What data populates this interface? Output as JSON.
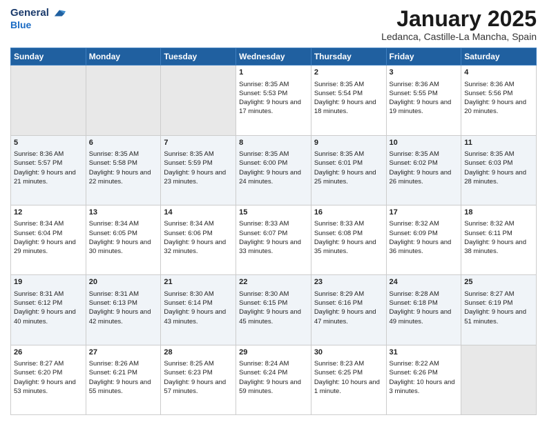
{
  "header": {
    "logo_general": "General",
    "logo_blue": "Blue",
    "month_title": "January 2025",
    "location": "Ledanca, Castille-La Mancha, Spain"
  },
  "weekdays": [
    "Sunday",
    "Monday",
    "Tuesday",
    "Wednesday",
    "Thursday",
    "Friday",
    "Saturday"
  ],
  "weeks": [
    [
      {
        "day": "",
        "empty": true
      },
      {
        "day": "",
        "empty": true
      },
      {
        "day": "",
        "empty": true
      },
      {
        "day": "1",
        "sunrise": "8:35 AM",
        "sunset": "5:53 PM",
        "daylight": "9 hours and 17 minutes."
      },
      {
        "day": "2",
        "sunrise": "8:35 AM",
        "sunset": "5:54 PM",
        "daylight": "9 hours and 18 minutes."
      },
      {
        "day": "3",
        "sunrise": "8:36 AM",
        "sunset": "5:55 PM",
        "daylight": "9 hours and 19 minutes."
      },
      {
        "day": "4",
        "sunrise": "8:36 AM",
        "sunset": "5:56 PM",
        "daylight": "9 hours and 20 minutes."
      }
    ],
    [
      {
        "day": "5",
        "sunrise": "8:36 AM",
        "sunset": "5:57 PM",
        "daylight": "9 hours and 21 minutes."
      },
      {
        "day": "6",
        "sunrise": "8:35 AM",
        "sunset": "5:58 PM",
        "daylight": "9 hours and 22 minutes."
      },
      {
        "day": "7",
        "sunrise": "8:35 AM",
        "sunset": "5:59 PM",
        "daylight": "9 hours and 23 minutes."
      },
      {
        "day": "8",
        "sunrise": "8:35 AM",
        "sunset": "6:00 PM",
        "daylight": "9 hours and 24 minutes."
      },
      {
        "day": "9",
        "sunrise": "8:35 AM",
        "sunset": "6:01 PM",
        "daylight": "9 hours and 25 minutes."
      },
      {
        "day": "10",
        "sunrise": "8:35 AM",
        "sunset": "6:02 PM",
        "daylight": "9 hours and 26 minutes."
      },
      {
        "day": "11",
        "sunrise": "8:35 AM",
        "sunset": "6:03 PM",
        "daylight": "9 hours and 28 minutes."
      }
    ],
    [
      {
        "day": "12",
        "sunrise": "8:34 AM",
        "sunset": "6:04 PM",
        "daylight": "9 hours and 29 minutes."
      },
      {
        "day": "13",
        "sunrise": "8:34 AM",
        "sunset": "6:05 PM",
        "daylight": "9 hours and 30 minutes."
      },
      {
        "day": "14",
        "sunrise": "8:34 AM",
        "sunset": "6:06 PM",
        "daylight": "9 hours and 32 minutes."
      },
      {
        "day": "15",
        "sunrise": "8:33 AM",
        "sunset": "6:07 PM",
        "daylight": "9 hours and 33 minutes."
      },
      {
        "day": "16",
        "sunrise": "8:33 AM",
        "sunset": "6:08 PM",
        "daylight": "9 hours and 35 minutes."
      },
      {
        "day": "17",
        "sunrise": "8:32 AM",
        "sunset": "6:09 PM",
        "daylight": "9 hours and 36 minutes."
      },
      {
        "day": "18",
        "sunrise": "8:32 AM",
        "sunset": "6:11 PM",
        "daylight": "9 hours and 38 minutes."
      }
    ],
    [
      {
        "day": "19",
        "sunrise": "8:31 AM",
        "sunset": "6:12 PM",
        "daylight": "9 hours and 40 minutes."
      },
      {
        "day": "20",
        "sunrise": "8:31 AM",
        "sunset": "6:13 PM",
        "daylight": "9 hours and 42 minutes."
      },
      {
        "day": "21",
        "sunrise": "8:30 AM",
        "sunset": "6:14 PM",
        "daylight": "9 hours and 43 minutes."
      },
      {
        "day": "22",
        "sunrise": "8:30 AM",
        "sunset": "6:15 PM",
        "daylight": "9 hours and 45 minutes."
      },
      {
        "day": "23",
        "sunrise": "8:29 AM",
        "sunset": "6:16 PM",
        "daylight": "9 hours and 47 minutes."
      },
      {
        "day": "24",
        "sunrise": "8:28 AM",
        "sunset": "6:18 PM",
        "daylight": "9 hours and 49 minutes."
      },
      {
        "day": "25",
        "sunrise": "8:27 AM",
        "sunset": "6:19 PM",
        "daylight": "9 hours and 51 minutes."
      }
    ],
    [
      {
        "day": "26",
        "sunrise": "8:27 AM",
        "sunset": "6:20 PM",
        "daylight": "9 hours and 53 minutes."
      },
      {
        "day": "27",
        "sunrise": "8:26 AM",
        "sunset": "6:21 PM",
        "daylight": "9 hours and 55 minutes."
      },
      {
        "day": "28",
        "sunrise": "8:25 AM",
        "sunset": "6:23 PM",
        "daylight": "9 hours and 57 minutes."
      },
      {
        "day": "29",
        "sunrise": "8:24 AM",
        "sunset": "6:24 PM",
        "daylight": "9 hours and 59 minutes."
      },
      {
        "day": "30",
        "sunrise": "8:23 AM",
        "sunset": "6:25 PM",
        "daylight": "10 hours and 1 minute."
      },
      {
        "day": "31",
        "sunrise": "8:22 AM",
        "sunset": "6:26 PM",
        "daylight": "10 hours and 3 minutes."
      },
      {
        "day": "",
        "empty": true
      }
    ]
  ]
}
